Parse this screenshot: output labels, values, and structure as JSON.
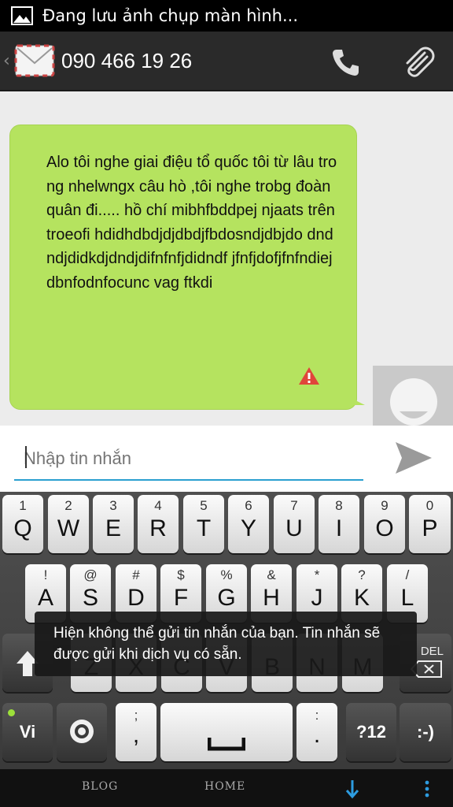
{
  "status_bar": {
    "notification_text": "Đang lưu ảnh chụp màn hình..."
  },
  "header": {
    "back_glyph": "‹",
    "contact_number": "090 466 19 26",
    "icons": [
      "envelope-icon",
      "phone-icon",
      "paperclip-icon"
    ]
  },
  "conversation": {
    "message_text": "Alo tôi nghe giai điệu tổ quốc tôi từ lâu trong nhelwngx câu hò ,tôi nghe trobg đoàn quân đi..... hồ chí mibhfbddpej njaats trên troeofi hdidhdbdjdjdbdjfbdosndjdbjdo dndndjdidkdjdndjdifnfnfjdidndf jfnfjdofjfnfndiejdbnfodnfocunc vag ftkdi",
    "status_icon": "warning-icon",
    "bubble_color": "#b5e35f"
  },
  "compose": {
    "placeholder": "Nhập tin nhắn",
    "send_icon": "send-icon",
    "accent_color": "#2ba0d0"
  },
  "keyboard": {
    "row1": [
      {
        "num": "1",
        "key": "Q"
      },
      {
        "num": "2",
        "key": "W"
      },
      {
        "num": "3",
        "key": "E"
      },
      {
        "num": "4",
        "key": "R"
      },
      {
        "num": "5",
        "key": "T"
      },
      {
        "num": "6",
        "key": "Y"
      },
      {
        "num": "7",
        "key": "U"
      },
      {
        "num": "8",
        "key": "I"
      },
      {
        "num": "9",
        "key": "O"
      },
      {
        "num": "0",
        "key": "P"
      }
    ],
    "row2": [
      {
        "num": "!",
        "key": "A"
      },
      {
        "num": "@",
        "key": "S"
      },
      {
        "num": "#",
        "key": "D"
      },
      {
        "num": "$",
        "key": "F"
      },
      {
        "num": "%",
        "key": "G"
      },
      {
        "num": "&",
        "key": "H"
      },
      {
        "num": "*",
        "key": "J"
      },
      {
        "num": "?",
        "key": "K"
      },
      {
        "num": "/",
        "key": "L"
      }
    ],
    "row3": [
      {
        "num": "",
        "key": "Z"
      },
      {
        "num": "",
        "key": "X"
      },
      {
        "num": "",
        "key": "C"
      },
      {
        "num": "",
        "key": "V"
      },
      {
        "num": "",
        "key": "B"
      },
      {
        "num": "",
        "key": "N"
      },
      {
        "num": "",
        "key": "M"
      }
    ],
    "delete_label": "DEL",
    "lang_label": "Vi",
    "comma_top": ";",
    "comma_main": ",",
    "period_top": ":",
    "period_main": ".",
    "symbols_label": "?12",
    "smiley_label": ":-)"
  },
  "toast": {
    "text": "Hiện không thể gửi tin nhắn của bạn. Tin nhắn sẽ được gửi khi dịch vụ có sẵn."
  },
  "nav_bar": {
    "back_label": "BLOG",
    "home_label": "HOME"
  }
}
